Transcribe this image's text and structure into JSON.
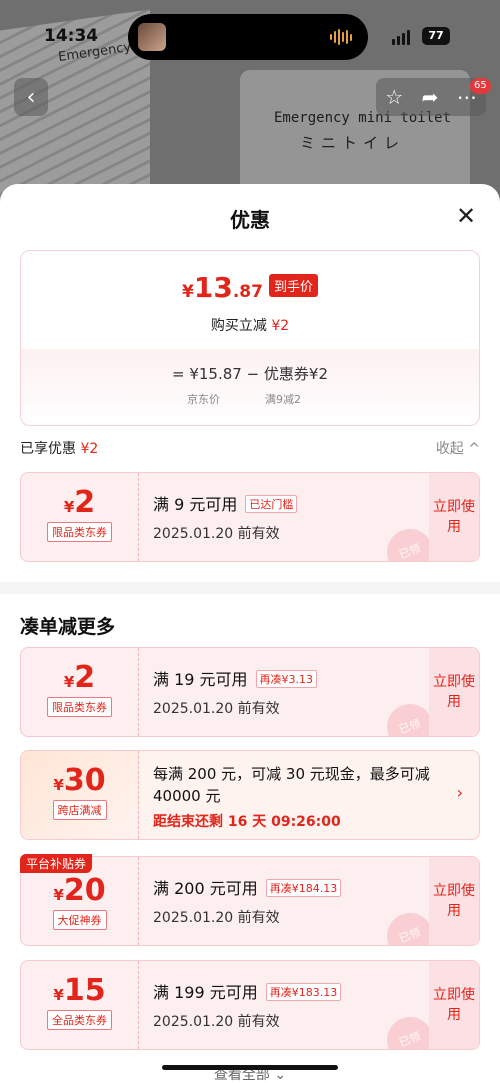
{
  "status_bar": {
    "time": "14:34",
    "battery": "77"
  },
  "background": {
    "pkg_text1": "Emergency mini toilet",
    "pkg_text2": "ミニトイレ",
    "pkg_text3": "Emergency"
  },
  "nav": {
    "back_icon": "chevron-left-icon",
    "badge": "65"
  },
  "sheet": {
    "title": "优惠",
    "price": {
      "currency": "¥",
      "integer": "13",
      "decimal": ".87",
      "tag": "到手价",
      "instant_label": "购买立减",
      "instant_value": "¥2",
      "formula": "=  ¥15.87  −  优惠券¥2",
      "sub_left": "京东价",
      "sub_right": "满9减2"
    },
    "enjoyed": {
      "label": "已享优惠",
      "value": "¥2",
      "collapse": "收起 ^"
    },
    "applied_coupon": {
      "currency": "¥",
      "amount": "2",
      "kind": "限品类东券",
      "condition": "满 9 元可用",
      "chip": "已达门槛",
      "date": "2025.01.20 前有效",
      "action": "立即使用",
      "stamp": "已领"
    },
    "more_title": "凑单减更多",
    "coupons": [
      {
        "currency": "¥",
        "amount": "2",
        "kind": "限品类东券",
        "condition": "满 19 元可用",
        "chip": "再凑¥3.13",
        "date": "2025.01.20 前有效",
        "action": "立即使用",
        "stamp": "已领"
      },
      {
        "currency": "¥",
        "amount": "30",
        "kind": "跨店满减",
        "promo_text": "每满 200 元，可减 30 元现金，最多可减 40000 元",
        "countdown": "距结束还剩 16 天 09:26:00"
      },
      {
        "platform_tag": "平台补贴券",
        "currency": "¥",
        "amount": "20",
        "kind": "大促神券",
        "condition": "满 200 元可用",
        "chip": "再凑¥184.13",
        "date": "2025.01.20 前有效",
        "action": "立即使用",
        "stamp": "已领"
      },
      {
        "currency": "¥",
        "amount": "15",
        "kind": "全品类东券",
        "condition": "满 199 元可用",
        "chip": "再凑¥183.13",
        "date": "2025.01.20 前有效",
        "action": "立即使用",
        "stamp": "已领"
      }
    ],
    "view_all": "查看全部 ⌄"
  }
}
